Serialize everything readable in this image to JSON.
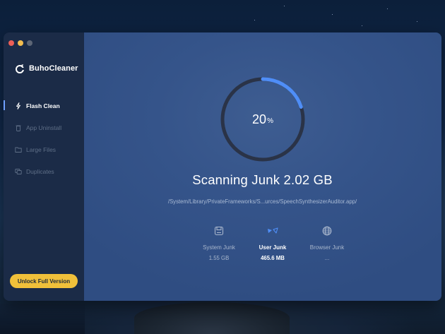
{
  "app": {
    "name": "BuhoCleaner"
  },
  "sidebar": {
    "items": [
      {
        "label": "Flash Clean",
        "icon": "flash-icon",
        "active": true
      },
      {
        "label": "App Uninstall",
        "icon": "trash-icon",
        "active": false
      },
      {
        "label": "Large Files",
        "icon": "folder-icon",
        "active": false
      },
      {
        "label": "Duplicates",
        "icon": "duplicates-icon",
        "active": false
      }
    ],
    "unlock_label": "Unlock Full Version"
  },
  "scan": {
    "progress_percent": 20,
    "percent_value": "20",
    "percent_unit": "%",
    "title": "Scanning Junk 2.02 GB",
    "current_path": "/System/Library/PrivateFrameworks/S...urces/SpeechSynthesizerAuditor.app/"
  },
  "categories": [
    {
      "label": "System Junk",
      "value": "1.55 GB",
      "icon": "disk-icon",
      "active": false
    },
    {
      "label": "User Junk",
      "value": "465.6 MB",
      "icon": "user-junk-icon",
      "active": true
    },
    {
      "label": "Browser Junk",
      "value": "...",
      "icon": "globe-icon",
      "active": false
    }
  ],
  "colors": {
    "sidebar_bg": "#1b2b47",
    "main_bg": "#35548a",
    "accent": "#4f8ef7",
    "unlock_button": "#f0c03a"
  }
}
